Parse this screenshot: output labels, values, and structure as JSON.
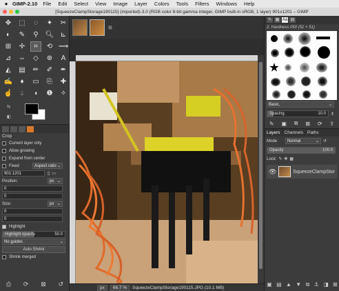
{
  "menubar": {
    "apple": "",
    "app": "GIMP-2.10",
    "items": [
      "File",
      "Edit",
      "Select",
      "View",
      "Image",
      "Layer",
      "Colors",
      "Tools",
      "Filters",
      "Windows",
      "Help"
    ]
  },
  "window": {
    "title": "[SqueezeClampStorage190115] (imported)-3.0 (RGB color 8-bit gamma integer, GIMP built-in sRGB, 1 layer) 901x1201 – GIMP"
  },
  "tool_options": {
    "title": "Crop",
    "current_layer_only": "Current layer only",
    "allow_growing": "Allow growing",
    "expand_from_center": "Expand from center",
    "fixed_label": "Fixed",
    "fixed_value": "Aspect ratio",
    "ratio_value": "901:1201",
    "position_label": "Position:",
    "position_unit": "px",
    "position_x": "0",
    "position_y": "0",
    "size_label": "Size:",
    "size_unit": "px",
    "size_x": "0",
    "size_y": "0",
    "highlight_label": "Highlight",
    "highlight_opacity_label": "Highlight opacity",
    "highlight_opacity_value": "50.0",
    "guides_value": "No guides",
    "auto_shrink": "Auto Shrink",
    "shrink_merged": "Shrink merged"
  },
  "colors": {
    "accent_orange": "#d97a2a",
    "dark_bg": "#3c3c3c",
    "menubar_bg": "#e8e8e8",
    "close": "#fc5f57",
    "minimize": "#fdbc2e",
    "maximize": "#28c840"
  },
  "statusbar": {
    "unit": "px",
    "zoom": "66.7 %",
    "file_info": "SqueezeClampStorage190115.JPG (10.1 MB)"
  },
  "brushes": {
    "name": "2. Hardness 050 (51 × 51)",
    "filter_value": "Basic,",
    "spacing_label": "Spacing",
    "spacing_value": "10.0"
  },
  "layers": {
    "tab_layers": "Layers",
    "tab_channels": "Channels",
    "tab_paths": "Paths",
    "mode_label": "Mode",
    "mode_value": "Normal",
    "opacity_label": "Opacity",
    "opacity_value": "100.0",
    "lock_label": "Lock:",
    "layer_name": "SqueezeClampStor"
  }
}
